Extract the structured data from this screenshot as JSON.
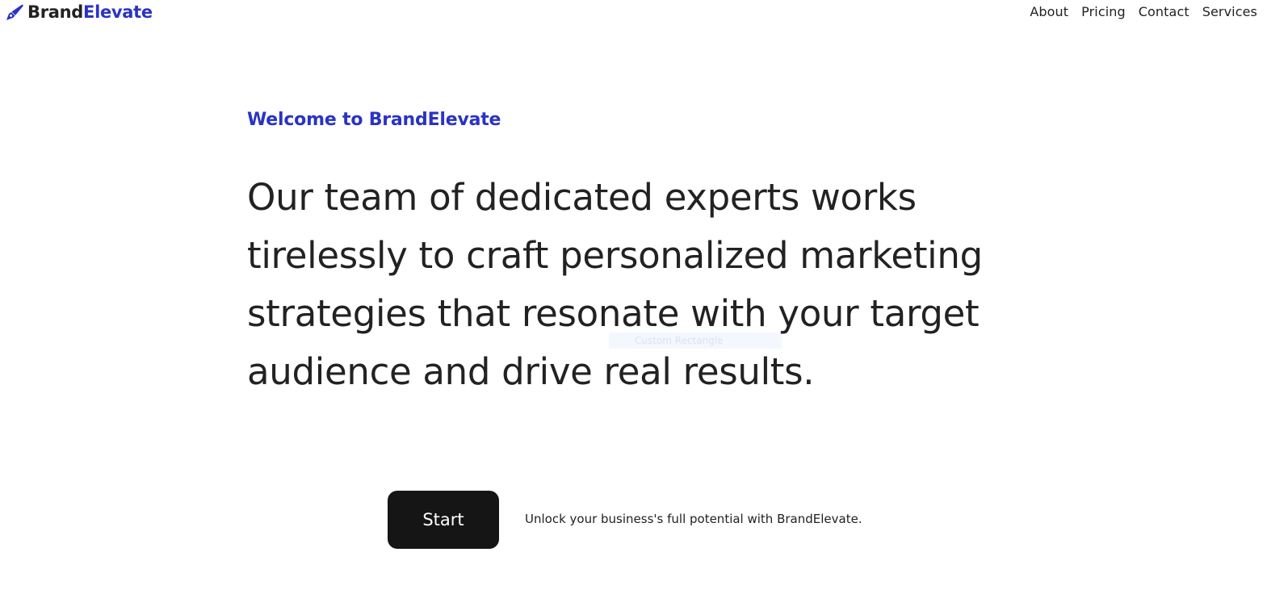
{
  "header": {
    "logo_icon": "pen-nib-icon",
    "logo_primary": "Brand",
    "logo_accent": "Elevate",
    "nav": [
      {
        "label": "About"
      },
      {
        "label": "Pricing"
      },
      {
        "label": "Contact"
      },
      {
        "label": "Services"
      }
    ]
  },
  "hero": {
    "eyebrow": "Welcome to BrandElevate",
    "headline": "Our team of dedicated experts works tirelessly to craft personalized marketing strategies that resonate with your target audience and drive real results.",
    "ghost_label": "Custom Rectangle",
    "cta_label": "Start",
    "tagline": "Unlock your business's full potential with BrandElevate."
  },
  "colors": {
    "accent": "#2a33c4",
    "text": "#222222",
    "button_bg": "#151515"
  }
}
